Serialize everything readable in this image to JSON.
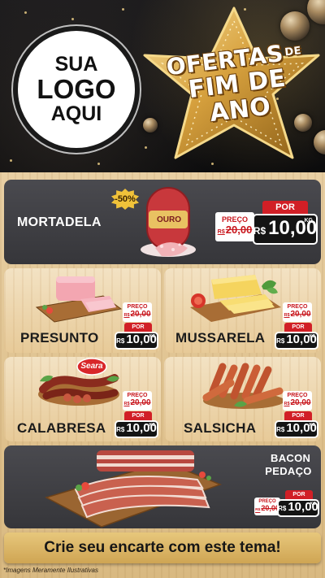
{
  "header": {
    "logo": {
      "line1": "SUA",
      "line2": "LOGO",
      "line3": "AQUI"
    },
    "promo": {
      "line1": "OFERTAS",
      "de": "DE",
      "line2": "FIM DE ANO"
    }
  },
  "featured": {
    "name": "MORTADELA",
    "discount_badge": "-50%",
    "brand_label": "OURO",
    "price_tag_label": "PREÇO",
    "old_price_currency": "R$",
    "old_price": "20,00",
    "por_label": "POR",
    "currency": "R$",
    "price": "10,00",
    "unit": "KG"
  },
  "products": [
    {
      "name": "PRESUNTO",
      "price_tag_label": "PREÇO",
      "old_price_currency": "R$",
      "old_price": "20,00",
      "por_label": "POR",
      "currency": "R$",
      "price": "10,00",
      "unit": "KG"
    },
    {
      "name": "MUSSARELA",
      "price_tag_label": "PREÇO",
      "old_price_currency": "R$",
      "old_price": "20,00",
      "por_label": "POR",
      "currency": "R$",
      "price": "10,00",
      "unit": "KG"
    },
    {
      "name": "CALABRESA",
      "brand_label": "Seara",
      "price_tag_label": "PREÇO",
      "old_price_currency": "R$",
      "old_price": "20,00",
      "por_label": "POR",
      "currency": "R$",
      "price": "10,00",
      "unit": "KG"
    },
    {
      "name": "SALSICHA",
      "price_tag_label": "PREÇO",
      "old_price_currency": "R$",
      "old_price": "20,00",
      "por_label": "POR",
      "currency": "R$",
      "price": "10,00",
      "unit": "KG"
    }
  ],
  "bacon": {
    "name_line1": "BACON",
    "name_line2": "PEDAÇO",
    "price_tag_label": "PREÇO",
    "old_price_currency": "R$",
    "old_price": "20,00",
    "por_label": "POR",
    "currency": "R$",
    "price": "10,00",
    "unit": "KG"
  },
  "footer": {
    "cta": "Crie seu encarte com este tema!",
    "disclaimer": "*Imagens Meramente Ilustrativas"
  },
  "colors": {
    "accent_red": "#d11f26",
    "gold": "#e7c77c",
    "dark_card": "#414145",
    "price_box": "#141414"
  }
}
